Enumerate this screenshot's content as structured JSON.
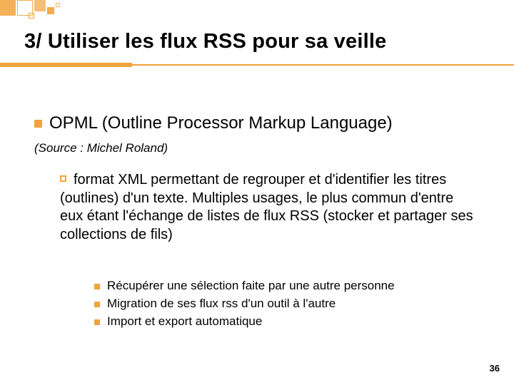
{
  "title": "3/ Utiliser les flux RSS pour sa veille",
  "level1": {
    "text": "OPML (Outline Processor Markup Language)",
    "source": "(Source : Michel Roland)"
  },
  "level2": {
    "text": "format XML permettant de regrouper et d'identifier les titres (outlines) d'un texte. Multiples usages, le plus commun d'entre eux étant l'échange de listes de flux RSS (stocker et partager ses collections de fils)"
  },
  "level3": {
    "items": [
      "Récupérer une sélection faite par une autre personne",
      "Migration de ses flux rss d'un outil à l'autre",
      "Import et export automatique"
    ]
  },
  "page_number": "36",
  "accent_color": "#f2a33a"
}
